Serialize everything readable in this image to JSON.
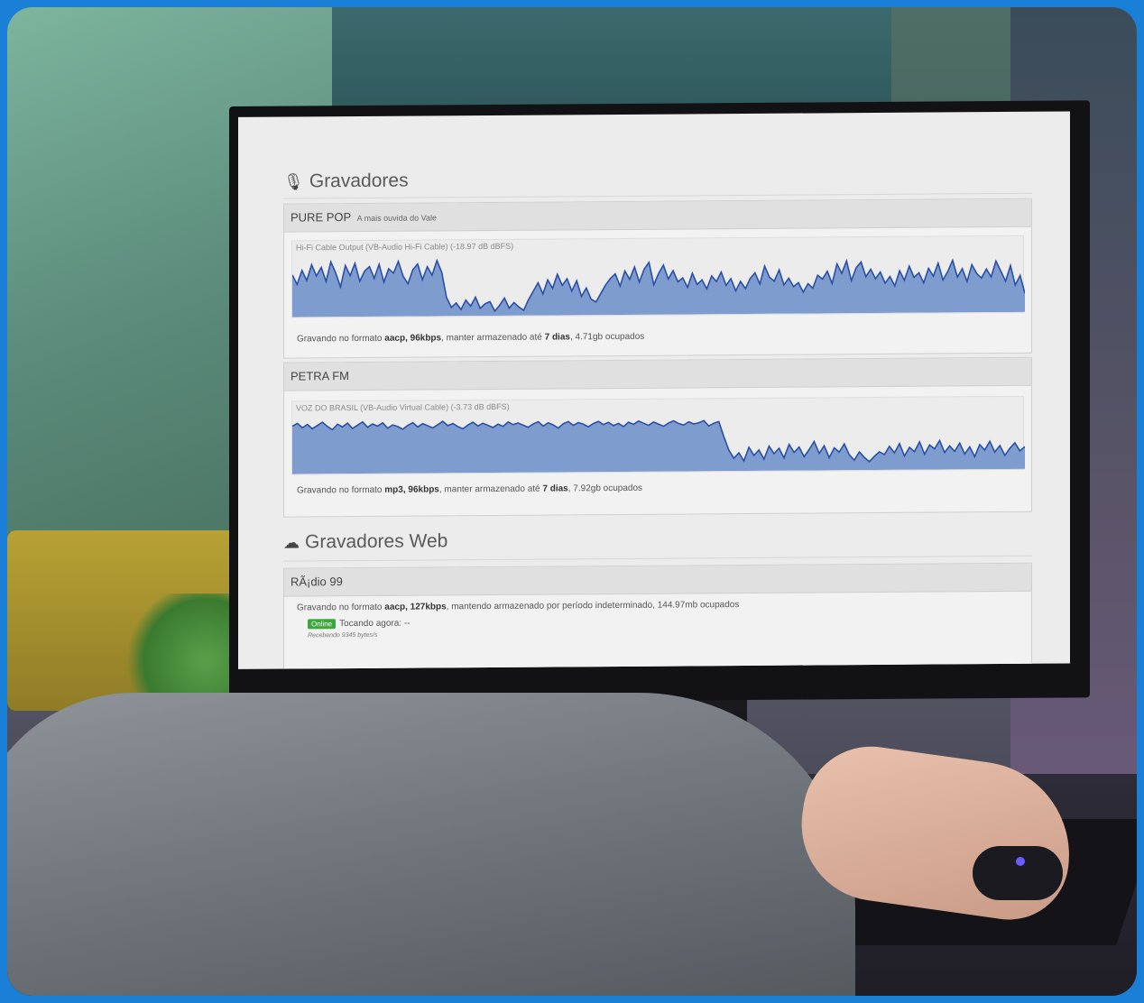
{
  "recorders": {
    "title": "Gravadores",
    "stations": [
      {
        "name": "PURE POP",
        "tagline": "A mais ouvida do Vale",
        "source_label": "Hi-Fi Cable Output (VB-Audio Hi-Fi Cable) (-18.97 dB dBFS)",
        "status_prefix": "Gravando no formato",
        "format": "aacp, 96kbps",
        "status_middle": ", manter armazenado até",
        "retention": "7 dias",
        "status_suffix": ", 4.71gb ocupados"
      },
      {
        "name": "PETRA FM",
        "tagline": "",
        "source_label": "VOZ DO BRASIL (VB-Audio Virtual Cable) (-3.73 dB dBFS)",
        "status_prefix": "Gravando no formato",
        "format": "mp3, 96kbps",
        "status_middle": ", manter armazenado até",
        "retention": "7 dias",
        "status_suffix": ", 7.92gb ocupados"
      }
    ]
  },
  "web_recorders": {
    "title": "Gravadores Web",
    "stations": [
      {
        "name": "RÃ¡dio 99",
        "status_prefix": "Gravando no formato",
        "format": "aacp, 127kbps",
        "status_suffix": ", mantendo armazenado por período indeterminado, 144.97mb ocupados",
        "badge": "Online",
        "now_playing": "Tocando agora: --",
        "receiving": "Recebendo 9345 bytes/s"
      }
    ]
  },
  "colors": {
    "waveform_fill": "#7f9ccf",
    "waveform_stroke": "#2a4fa8",
    "online_badge": "#3aa83a"
  },
  "waveforms": {
    "pure_pop": [
      0.72,
      0.55,
      0.8,
      0.62,
      0.9,
      0.7,
      0.85,
      0.6,
      0.95,
      0.75,
      0.5,
      0.88,
      0.7,
      0.92,
      0.6,
      0.78,
      0.86,
      0.65,
      0.9,
      0.58,
      0.82,
      0.74,
      0.95,
      0.68,
      0.55,
      0.8,
      0.9,
      0.62,
      0.85,
      0.7,
      0.96,
      0.75,
      0.3,
      0.12,
      0.2,
      0.08,
      0.25,
      0.14,
      0.3,
      0.1,
      0.18,
      0.22,
      0.05,
      0.15,
      0.28,
      0.1,
      0.2,
      0.12,
      0.06,
      0.25,
      0.4,
      0.55,
      0.35,
      0.6,
      0.45,
      0.7,
      0.5,
      0.62,
      0.4,
      0.58,
      0.3,
      0.45,
      0.25,
      0.2,
      0.35,
      0.5,
      0.62,
      0.7,
      0.48,
      0.75,
      0.6,
      0.82,
      0.55,
      0.78,
      0.9,
      0.5,
      0.7,
      0.85,
      0.6,
      0.75,
      0.55,
      0.62,
      0.45,
      0.7,
      0.5,
      0.58,
      0.42,
      0.65,
      0.55,
      0.72,
      0.48,
      0.6,
      0.38,
      0.55,
      0.42,
      0.6,
      0.7,
      0.5,
      0.82,
      0.62,
      0.55,
      0.75,
      0.48,
      0.6,
      0.45,
      0.52,
      0.35,
      0.5,
      0.42,
      0.65,
      0.58,
      0.72,
      0.5,
      0.85,
      0.68,
      0.9,
      0.55,
      0.78,
      0.88,
      0.62,
      0.75,
      0.58,
      0.7,
      0.5,
      0.62,
      0.45,
      0.72,
      0.55,
      0.8,
      0.6,
      0.68,
      0.5,
      0.76,
      0.62,
      0.85,
      0.55,
      0.7,
      0.9,
      0.6,
      0.75,
      0.52,
      0.82,
      0.66,
      0.58,
      0.74,
      0.6,
      0.88,
      0.7,
      0.52,
      0.8,
      0.45,
      0.62,
      0.3
    ],
    "petra_fm": [
      0.85,
      0.9,
      0.82,
      0.88,
      0.8,
      0.86,
      0.92,
      0.84,
      0.78,
      0.88,
      0.83,
      0.9,
      0.8,
      0.86,
      0.92,
      0.82,
      0.88,
      0.84,
      0.9,
      0.8,
      0.86,
      0.83,
      0.78,
      0.85,
      0.9,
      0.82,
      0.88,
      0.84,
      0.8,
      0.86,
      0.92,
      0.84,
      0.88,
      0.82,
      0.78,
      0.85,
      0.9,
      0.83,
      0.88,
      0.84,
      0.8,
      0.86,
      0.82,
      0.9,
      0.85,
      0.88,
      0.84,
      0.8,
      0.86,
      0.9,
      0.82,
      0.88,
      0.84,
      0.78,
      0.86,
      0.9,
      0.83,
      0.88,
      0.85,
      0.8,
      0.86,
      0.9,
      0.84,
      0.88,
      0.82,
      0.86,
      0.8,
      0.88,
      0.84,
      0.9,
      0.86,
      0.82,
      0.88,
      0.84,
      0.8,
      0.86,
      0.9,
      0.85,
      0.82,
      0.88,
      0.84,
      0.86,
      0.9,
      0.8,
      0.85,
      0.88,
      0.6,
      0.35,
      0.2,
      0.3,
      0.15,
      0.4,
      0.25,
      0.35,
      0.18,
      0.42,
      0.28,
      0.38,
      0.2,
      0.45,
      0.3,
      0.4,
      0.22,
      0.35,
      0.5,
      0.28,
      0.42,
      0.2,
      0.38,
      0.3,
      0.45,
      0.25,
      0.15,
      0.3,
      0.2,
      0.12,
      0.22,
      0.3,
      0.25,
      0.4,
      0.28,
      0.45,
      0.22,
      0.38,
      0.3,
      0.48,
      0.25,
      0.42,
      0.35,
      0.5,
      0.28,
      0.4,
      0.3,
      0.45,
      0.25,
      0.38,
      0.2,
      0.42,
      0.32,
      0.48,
      0.28,
      0.4,
      0.22,
      0.35,
      0.45,
      0.3,
      0.38
    ]
  }
}
